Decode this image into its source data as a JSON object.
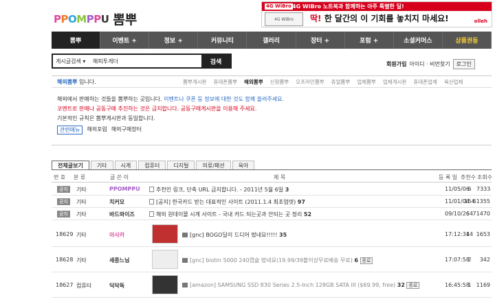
{
  "header": {
    "logo_en": [
      "P",
      "P",
      "O",
      "M",
      "P",
      "P",
      "U"
    ],
    "logo_ko": "뽐뿌",
    "banner": {
      "tag": "4G WiBro",
      "device": "4G WiBro",
      "top_text": "4G WiBro 노트북과 함께하는 아주 특별한 딜!",
      "headline_em": "딱!",
      "headline": " 한 달간의 이 기회를 놓치지 마세요!",
      "brand": "olleh"
    }
  },
  "nav": {
    "items": [
      "뽐뿌",
      "이벤트 +",
      "정보 +",
      "커뮤니티",
      "갤러리",
      "장터 +",
      "포럼 +",
      "소셜커머스",
      "상품권등"
    ]
  },
  "search": {
    "select_label": "게시글검색 ▾",
    "value": "해피투게더",
    "button": "검색"
  },
  "userbar": {
    "join": "회원가입",
    "links": "아이디 · 비번찾기",
    "login": "로그인"
  },
  "subnav": {
    "board_name": "해외뽐뿌",
    "suffix": " 입니다.",
    "links": [
      "뽐뿌게시판",
      "휴대폰뽐뿌",
      "해외뽐뿌",
      "신청뽐뿌",
      "오프라인뽐뿌",
      "쥬얼뽐뿌",
      "업체뽐뿌",
      "업체게시판",
      "휴대폰업체",
      "육산업체"
    ]
  },
  "notice": {
    "line1_a": "해외에서 판매하는 것들을 뽐뿌하는 곳입니다. ",
    "line1_b": "이벤트나 쿠폰 등 정보에 대한 것도 함께 올려주세요.",
    "line2": "코멘트로 판매나 공동구매 추진하는 것은 금지합니다. 공동구매게시판을 이용해 주세요.",
    "line3": "기본적인 규칙은 뽐뿌게시판과 동일합니다.",
    "tags": [
      "관련메뉴",
      "해외포럼",
      "해외구매장터"
    ]
  },
  "tabs": [
    "전체글보기",
    "기타",
    "시계",
    "컴퓨터",
    "디지털",
    "의류/패션",
    "육아"
  ],
  "table": {
    "headers": [
      "번 호",
      "분 류",
      "글 쓴 이",
      "제 목",
      "등 록 일",
      "추천수",
      "조회수"
    ],
    "notices": [
      {
        "badge": "공지",
        "cat": "기타",
        "nick": "PPOMPPU",
        "title": "추천인 링크, 단축 URL 금지합니다. - 2011년 5월 6일",
        "cmt": "3",
        "date": "11/05/06",
        "rec": "6",
        "views": "7333"
      },
      {
        "badge": "공지",
        "cat": "기타",
        "nick": "치커모",
        "title": "[공지] 한국카드 받는 대표적인 사이트 (2011.1.4 최초업뎃)",
        "cmt": "97",
        "date": "11/01/04",
        "rec": "154",
        "views": "61355"
      },
      {
        "badge": "공지",
        "cat": "기타",
        "nick": "바드와이즈",
        "title": "해외 원데이몰 시계 사이트 - 국내 카드 되는곳과 안되는 곳 정리",
        "cmt": "52",
        "date": "09/10/26",
        "rec": "64",
        "views": "71470"
      }
    ],
    "posts": [
      {
        "no": "18629",
        "cat": "기타",
        "nick": "아사카",
        "title": "[gnc] BOGO딜이 드디어 떴네요!!!!!",
        "cmt": "35",
        "end": "",
        "date": "17:12:34",
        "rec": "14",
        "views": "1653"
      },
      {
        "no": "18628",
        "cat": "기타",
        "nick": "세종느님",
        "title": "[gnc] biotin 5000 240캡슐 떴네요(19.99/39불이상무료배송 무료)",
        "cmt": "6",
        "end": "종료",
        "date": "17:07:58",
        "rec": "2",
        "views": "342"
      },
      {
        "no": "18627",
        "cat": "컴퓨터",
        "nick": "딕닥독",
        "title": "[amazon] SAMSUNG SSD 830 Series 2.5-Inch 128GB SATA III ($69.99, free)",
        "cmt": "32",
        "end": "종료",
        "date": "16:45:58",
        "rec": "1",
        "views": "1169"
      }
    ]
  },
  "colors": {
    "nav_bg": "#555555",
    "accent_red": "#d6001c",
    "link_blue": "#2a6ac2",
    "highlight": "#ffd234"
  }
}
